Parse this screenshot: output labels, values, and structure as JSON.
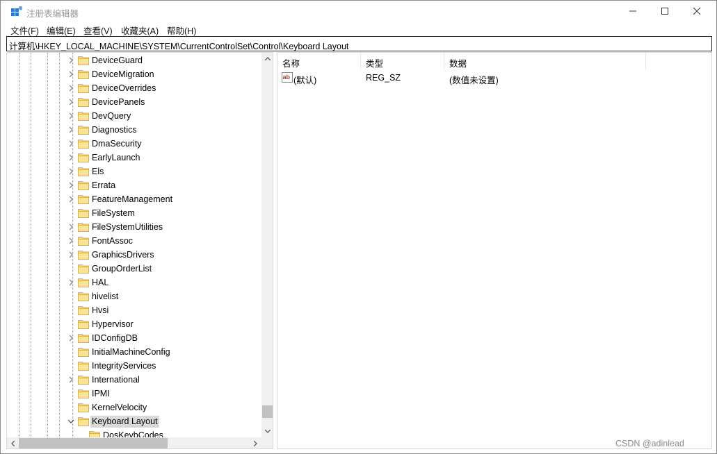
{
  "window": {
    "title": "注册表编辑器"
  },
  "menu": [
    "文件(F)",
    "编辑(E)",
    "查看(V)",
    "收藏夹(A)",
    "帮助(H)"
  ],
  "address": "计算机\\HKEY_LOCAL_MACHINE\\SYSTEM\\CurrentControlSet\\Control\\Keyboard Layout",
  "tree": {
    "items": [
      {
        "label": "DeviceGuard",
        "expandable": true
      },
      {
        "label": "DeviceMigration",
        "expandable": true
      },
      {
        "label": "DeviceOverrides",
        "expandable": true
      },
      {
        "label": "DevicePanels",
        "expandable": true
      },
      {
        "label": "DevQuery",
        "expandable": true
      },
      {
        "label": "Diagnostics",
        "expandable": true
      },
      {
        "label": "DmaSecurity",
        "expandable": true
      },
      {
        "label": "EarlyLaunch",
        "expandable": true
      },
      {
        "label": "Els",
        "expandable": true
      },
      {
        "label": "Errata",
        "expandable": true
      },
      {
        "label": "FeatureManagement",
        "expandable": true
      },
      {
        "label": "FileSystem",
        "expandable": false
      },
      {
        "label": "FileSystemUtilities",
        "expandable": true
      },
      {
        "label": "FontAssoc",
        "expandable": true
      },
      {
        "label": "GraphicsDrivers",
        "expandable": true
      },
      {
        "label": "GroupOrderList",
        "expandable": false
      },
      {
        "label": "HAL",
        "expandable": true
      },
      {
        "label": "hivelist",
        "expandable": false
      },
      {
        "label": "Hvsi",
        "expandable": false
      },
      {
        "label": "Hypervisor",
        "expandable": false
      },
      {
        "label": "IDConfigDB",
        "expandable": true
      },
      {
        "label": "InitialMachineConfig",
        "expandable": false
      },
      {
        "label": "IntegrityServices",
        "expandable": false
      },
      {
        "label": "International",
        "expandable": true
      },
      {
        "label": "IPMI",
        "expandable": false
      },
      {
        "label": "KernelVelocity",
        "expandable": false
      },
      {
        "label": "Keyboard Layout",
        "expandable": true,
        "expanded": true,
        "selected": true
      },
      {
        "label": "DosKeybCodes",
        "expandable": false,
        "child": true
      }
    ]
  },
  "list": {
    "headers": {
      "name": "名称",
      "type": "类型",
      "data": "数据"
    },
    "rows": [
      {
        "name": "(默认)",
        "type": "REG_SZ",
        "data": "(数值未设置)",
        "icon": "string-value-icon"
      }
    ]
  },
  "watermark": "CSDN @adinlead",
  "colors": {
    "folder": "#f6d77a",
    "folder_edge": "#d9b44a",
    "selection": "#d9d9d9",
    "regedit_blue": "#2c78d4",
    "ab_red": "#c0392b"
  }
}
